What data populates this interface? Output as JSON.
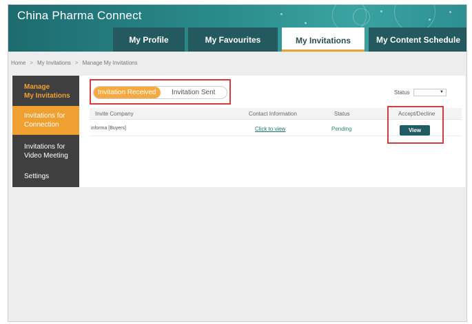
{
  "app": {
    "title": "China Pharma Connect"
  },
  "nav": {
    "tabs": [
      {
        "label": "My Profile"
      },
      {
        "label": "My Favourites"
      },
      {
        "label": "My Invitations"
      },
      {
        "label": "My Content Schedule"
      }
    ],
    "active_tab": "My Invitations"
  },
  "breadcrumb": {
    "items": [
      "Home",
      "My Invitations",
      "Manage My Invitations"
    ],
    "separator": ">"
  },
  "sidebar": {
    "heading_line1": "Manage",
    "heading_line2": "My Invitations",
    "items": [
      {
        "line1": "Invitations for",
        "line2": "Connection"
      },
      {
        "line1": "Invitations for",
        "line2": "Video Meeting"
      },
      {
        "line1": "Settings",
        "line2": ""
      }
    ]
  },
  "toggle": {
    "received_label": "Invitation Received",
    "sent_label": "Invitation Sent"
  },
  "status_filter": {
    "label": "Status",
    "value": ""
  },
  "table": {
    "headers": [
      "Invite Company",
      "Contact Information",
      "Status",
      "Accept/Decline"
    ],
    "rows": [
      {
        "company": "informa [Buyers]",
        "contact": "Click to view",
        "status": "Pending",
        "action": "View"
      }
    ]
  },
  "colors": {
    "accent_orange": "#f0a030",
    "header_teal": "#2a8a8b",
    "button_teal": "#1f5c63",
    "highlight_red": "#d63a3a"
  }
}
